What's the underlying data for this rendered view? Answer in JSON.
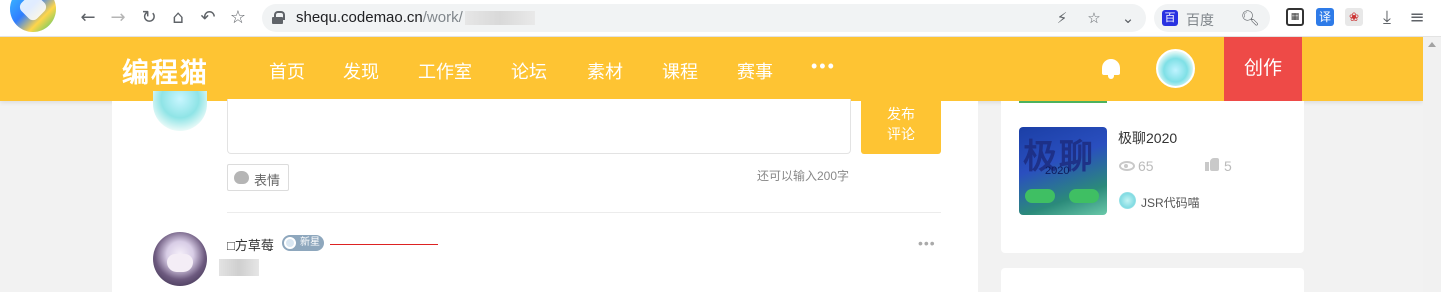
{
  "browser": {
    "url_host": "shequ.codemao.cn",
    "url_path": "/work/",
    "search_placeholder": "百度",
    "icons": [
      "back-icon",
      "forward-icon",
      "reload-icon",
      "home-icon",
      "undo-icon",
      "bookmark-star-icon",
      "lightning-icon",
      "star-icon",
      "chevron-down-icon",
      "search-icon",
      "qr-icon",
      "translate-icon",
      "extension-icon",
      "download-icon",
      "menu-icon"
    ],
    "ext_translate": "译",
    "ext_paw": "百"
  },
  "nav": {
    "logo": "编程猫",
    "items": [
      "首页",
      "发现",
      "工作室",
      "论坛",
      "素材",
      "课程",
      "赛事",
      "•••"
    ],
    "create_label": "创作",
    "brand_color": "#fec433",
    "create_color": "#ee4a47"
  },
  "comment_form": {
    "post_label_line1": "发布",
    "post_label_line2": "评论",
    "emoji_label": "表情",
    "char_count": "还可以输入200字"
  },
  "comment": {
    "author": "□方草莓",
    "badge": "新星",
    "more": "•••"
  },
  "sidebar": {
    "work": {
      "title": "极聊2020",
      "thumb_text": "极聊",
      "thumb_year": "2020",
      "views": "65",
      "likes": "5",
      "author": "JSR代码喵"
    }
  }
}
